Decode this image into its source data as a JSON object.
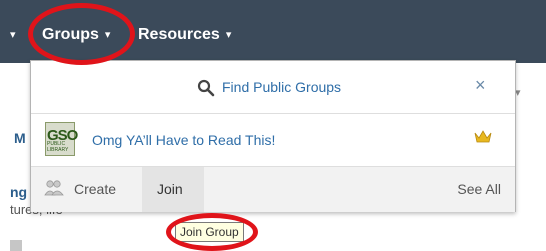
{
  "nav": {
    "groups_label": "Groups",
    "resources_label": "Resources",
    "caret": "▾"
  },
  "background": {
    "frag_1": "M",
    "frag_2": "ng",
    "frag_3": "tures, life"
  },
  "dropdown": {
    "search_label": "Find Public Groups",
    "close_glyph": "×",
    "group": {
      "name": "Omg YA’ll Have to Read This!",
      "logo_letters": "GSO",
      "logo_sub": "PUBLIC LIBRARY"
    },
    "create_label": "Create",
    "join_label": "Join",
    "see_all_label": "See All"
  },
  "tooltip": "Join Group",
  "colors": {
    "navbar": "#3b4a5a",
    "link": "#2f6ea8",
    "annotation": "#e0141a",
    "crown": "#e8b820"
  },
  "icons": {
    "search": "search-icon",
    "close": "close-icon",
    "crown": "crown-icon",
    "create": "create-group-icon"
  }
}
